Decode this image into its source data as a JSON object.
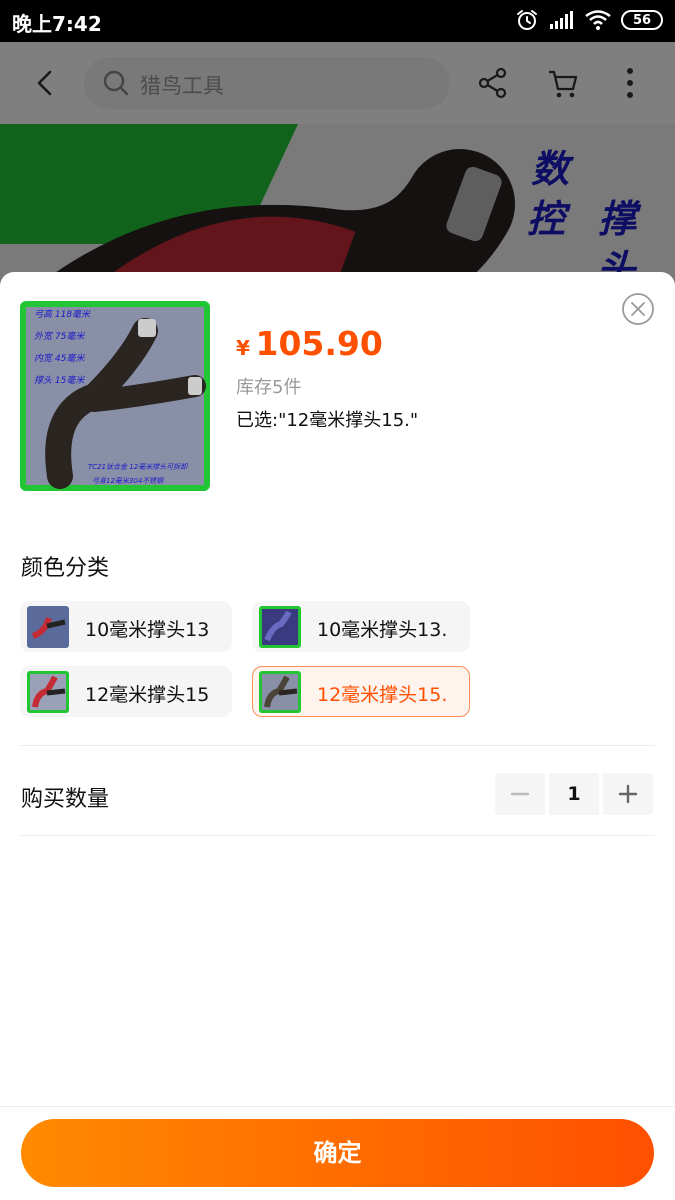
{
  "status_bar": {
    "time": "晚上7:42",
    "battery": "56"
  },
  "nav": {
    "search_placeholder": "猎鸟工具"
  },
  "hero": {
    "text_lines": [
      "数",
      "控",
      "撑",
      "头"
    ]
  },
  "sheet": {
    "price_symbol": "¥",
    "price": "105.90",
    "stock": "库存5件",
    "selected": "已选:\"12毫米撑头15.\"",
    "section_title": "颜色分类",
    "options": [
      {
        "label": "10毫米撑头13",
        "selected": false
      },
      {
        "label": "10毫米撑头13.",
        "selected": false
      },
      {
        "label": "12毫米撑头15",
        "selected": false
      },
      {
        "label": "12毫米撑头15.",
        "selected": true
      }
    ],
    "quantity_title": "购买数量",
    "quantity": "1",
    "confirm": "确定"
  },
  "thumb_text": {
    "lines": [
      "弓高 118毫米",
      "外宽 75毫米",
      "内宽 45毫米",
      "撑头 15毫米"
    ],
    "footer_1": "TC21钛合金 12毫米撑头可拆卸",
    "footer_2": "弓身12毫米304不锈钢"
  },
  "colors": {
    "accent": "#ff5000",
    "accent_light": "#ff8a00",
    "thumb_green": "#22c534"
  }
}
